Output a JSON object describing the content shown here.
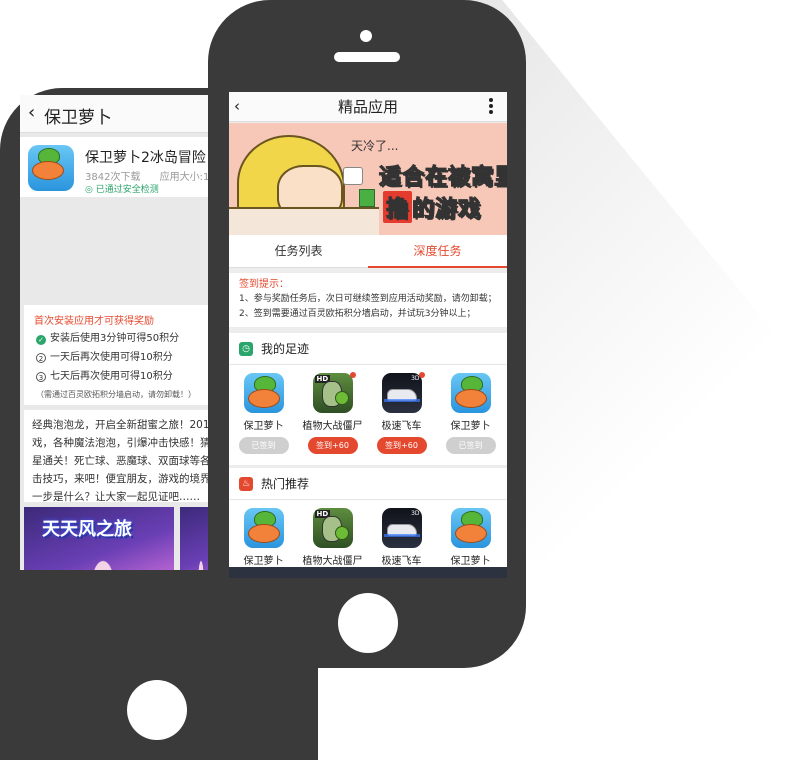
{
  "back_screen": {
    "title": "保卫萝卜",
    "app": {
      "name": "保卫萝卜2冰岛冒险",
      "downloads": "3842次下载",
      "size": "应用大小:1.",
      "secure": "已通过安全检测"
    },
    "reward": {
      "title": "首次安装应用才可获得奖励",
      "items": [
        {
          "marker": "✓",
          "text": "安装后使用3分钟可得50积分"
        },
        {
          "marker": "2",
          "text": "一天后再次使用可得10积分"
        },
        {
          "marker": "3",
          "text": "七天后再次使用可得10积分"
        }
      ],
      "note": "（需通过百灵欧拓积分墙启动，请勿卸载！）"
    },
    "description": [
      "经典泡泡龙，开启全新甜蜜之旅！201",
      "戏，各种魔法泡泡，引爆冲击快感！猜",
      "星通关！死亡球、恶魔球、双面球等各",
      "击技巧，来吧！便宜朋友，游戏的境界",
      "一步是什么？让大家一起见证吧……"
    ],
    "screenshot_logo": "天天风之旅"
  },
  "front_screen": {
    "title": "精品应用",
    "banner": {
      "line1": "天冷了...",
      "line2": "适合在被窝里",
      "line3_highlight": "撸",
      "line3_rest": "的游戏"
    },
    "tabs": [
      {
        "label": "任务列表",
        "active": false
      },
      {
        "label": "深度任务",
        "active": true
      }
    ],
    "tips": {
      "title": "签到提示：",
      "lines": [
        "1、参与奖励任务后，次日可继续签到应用活动奖励，请勿卸载；",
        "2、签到需要通过百灵欧拓积分墙启动，并试玩3分钟以上；"
      ]
    },
    "footprints": {
      "title": "我的足迹",
      "apps": [
        {
          "name": "保卫萝卜",
          "button": "已签到",
          "state": "done",
          "icon": "carrot-icon",
          "dot": false
        },
        {
          "name": "植物大战僵尸",
          "button": "签到+60",
          "state": "todo",
          "icon": "plants-zombies-icon",
          "dot": true
        },
        {
          "name": "极速飞车",
          "button": "签到+60",
          "state": "todo",
          "icon": "racing-car-icon",
          "dot": true
        },
        {
          "name": "保卫萝卜",
          "button": "已签到",
          "state": "done",
          "icon": "carrot-icon",
          "dot": false
        }
      ]
    },
    "hot": {
      "title": "热门推荐",
      "apps": [
        {
          "name": "保卫萝卜",
          "icon": "carrot-icon"
        },
        {
          "name": "植物大战僵尸",
          "icon": "plants-zombies-icon"
        },
        {
          "name": "极速飞车",
          "icon": "racing-car-icon"
        },
        {
          "name": "保卫萝卜",
          "icon": "carrot-icon"
        }
      ]
    }
  },
  "colors": {
    "phone_body": "#3a3a3a",
    "accent": "#e4492f",
    "secure_green": "#2aa56b",
    "done_button": "#cfcfcf"
  }
}
